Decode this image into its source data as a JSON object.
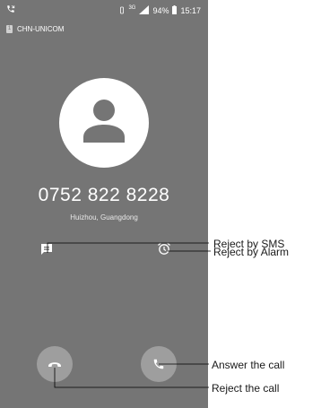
{
  "status_bar": {
    "network_type": "3G",
    "battery": "94%",
    "time": "15:17"
  },
  "carrier": {
    "sim_slot": "1",
    "name": "CHN-UNICOM"
  },
  "caller": {
    "number": "0752 822 8228",
    "location": "Huizhou, Guangdong"
  },
  "callouts": {
    "reject_sms": "Reject by SMS",
    "reject_alarm": "Reject by Alarm",
    "answer": "Answer the call",
    "reject": "Reject the call"
  },
  "colors": {
    "screen_bg": "#757575",
    "button_bg": "#9e9e9e",
    "icon": "#ffffff"
  },
  "icons": {
    "status_call": "phone-in-call-icon",
    "sms": "message-icon",
    "alarm": "alarm-icon",
    "reject": "call-end-icon",
    "answer": "phone-icon",
    "avatar": "person-icon"
  }
}
